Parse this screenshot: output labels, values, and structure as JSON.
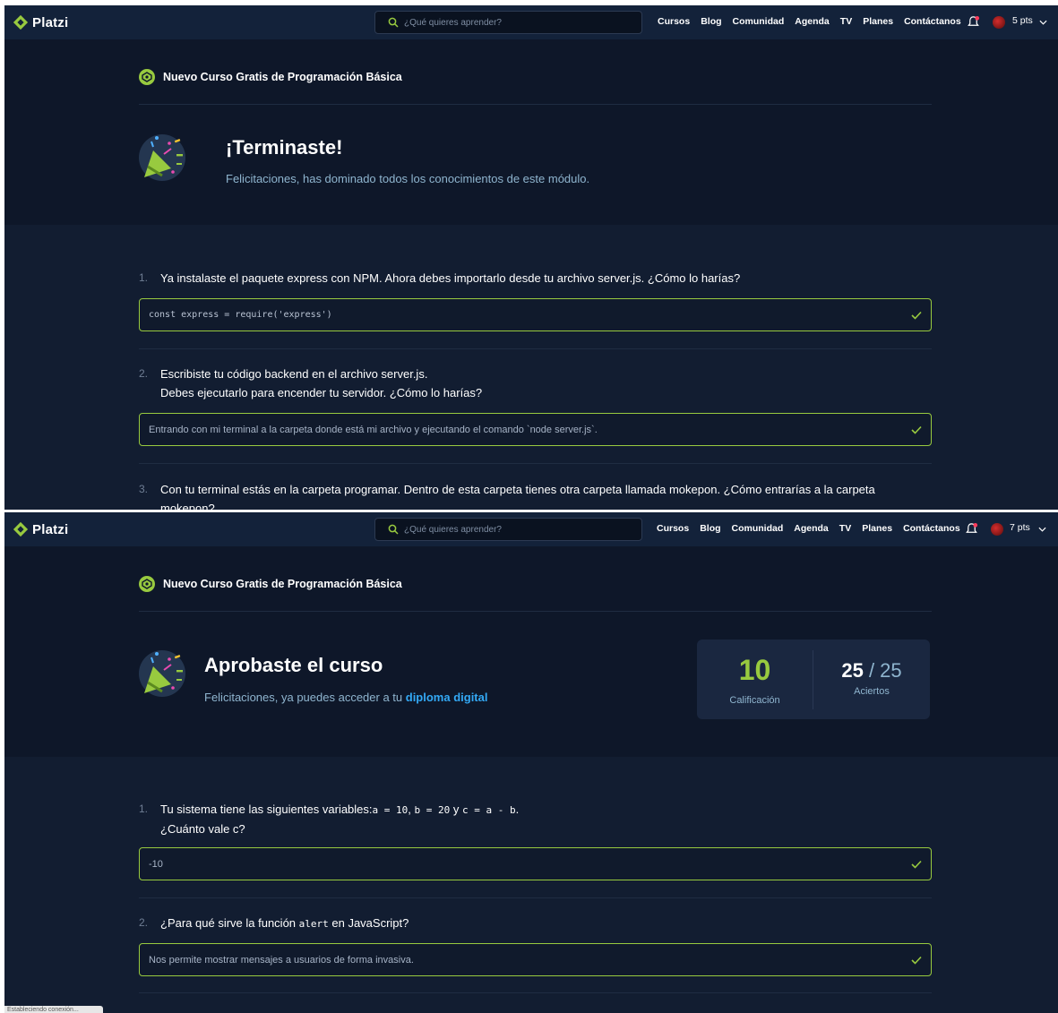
{
  "shot1": {
    "logo": "Platzi",
    "search_placeholder": "¿Qué quieres aprender?",
    "nav": [
      "Cursos",
      "Blog",
      "Comunidad",
      "Agenda",
      "TV",
      "Planes",
      "Contáctanos"
    ],
    "points": "5 pts",
    "course_title": "Nuevo Curso Gratis de Programación Básica",
    "result_title": "¡Terminaste!",
    "result_subtitle": "Felicitaciones, has dominado todos los conocimientos de este módulo.",
    "questions": [
      {
        "number": "1.",
        "text": "Ya instalaste el paquete express con NPM. Ahora debes importarlo desde tu archivo server.js. ¿Cómo lo harías?",
        "answer": "const express = require('express')"
      },
      {
        "number": "2.",
        "text_line1": "Escribiste tu código backend en el archivo server.js.",
        "text_line2": "Debes ejecutarlo para encender tu servidor. ¿Cómo lo harías?",
        "answer": "Entrando con mi terminal a la carpeta donde está mi archivo y ejecutando el comando `node server.js`."
      },
      {
        "number": "3.",
        "text": "Con tu terminal estás en la carpeta programar. Dentro de esta carpeta tienes otra carpeta llamada mokepon. ¿Cómo entrarías a la carpeta mokepon?"
      }
    ]
  },
  "shot2": {
    "logo": "Platzi",
    "search_placeholder": "¿Qué quieres aprender?",
    "nav": [
      "Cursos",
      "Blog",
      "Comunidad",
      "Agenda",
      "TV",
      "Planes",
      "Contáctanos"
    ],
    "points": "7 pts",
    "course_title": "Nuevo Curso Gratis de Programación Básica",
    "result_title": "Aprobaste el curso",
    "result_subtitle_prefix": "Felicitaciones, ya puedes acceder a tu ",
    "result_subtitle_link": "diploma digital",
    "score": "10",
    "score_label": "Calificación",
    "correct": "25",
    "total": "/ 25",
    "correct_label": "Aciertos",
    "questions": [
      {
        "number": "1.",
        "text_prefix": "Tu sistema tiene las siguientes variables:",
        "code_a": "a = 10",
        "sep1": ", ",
        "code_b": "b = 20",
        "sep2": " y ",
        "code_c": "c = a - b",
        "suffix": ".",
        "text_line2": "¿Cuánto vale c?",
        "answer": "-10"
      },
      {
        "number": "2.",
        "text_prefix": "¿Para qué sirve la función ",
        "code": "alert",
        "text_suffix": " en JavaScript?",
        "answer": "Nos permite mostrar mensajes a usuarios de forma invasiva."
      }
    ],
    "status": "Estableciendo conexión..."
  },
  "colors": {
    "background": "#0e1729",
    "topbar": "#13223a",
    "accent_green": "#98ca3f",
    "link_blue": "#33a9f5",
    "subtitle": "#8fb5cf"
  },
  "icons": [
    "platzi-logo-icon",
    "search-icon",
    "bell-icon",
    "chevron-down-icon",
    "course-badge-icon",
    "party-popper-icon",
    "check-icon"
  ]
}
